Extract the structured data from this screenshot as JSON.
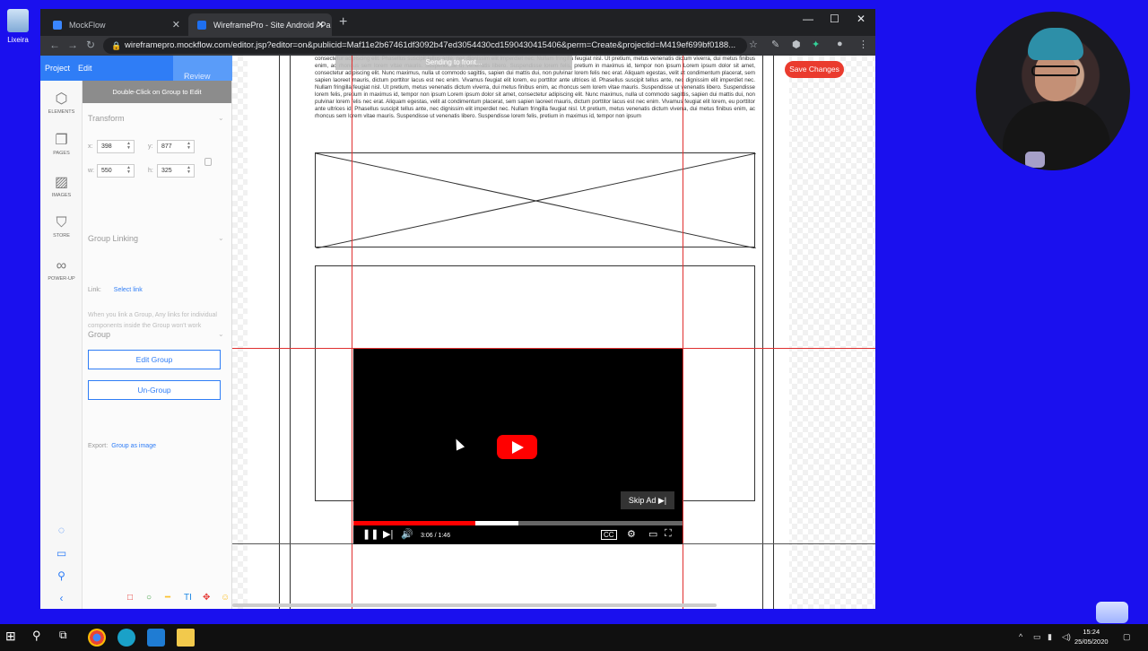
{
  "desktop": {
    "recycle_label": "Lixeira"
  },
  "browser": {
    "tabs": [
      {
        "label": "MockFlow",
        "active": false
      },
      {
        "label": "WireframePro - Site Android / Pa",
        "active": true
      }
    ],
    "url": "wireframepro.mockflow.com/editor.jsp?editor=on&publicid=Maf11e2b67461df3092b47ed3054430cd1590430415406&perm=Create&projectid=M419ef699bf0188..."
  },
  "app": {
    "menu": {
      "project": "Project",
      "edit": "Edit",
      "review": "Review"
    },
    "rail": [
      {
        "label": "ELEMENTS",
        "icon": "cube-icon"
      },
      {
        "label": "PAGES",
        "icon": "pages-icon"
      },
      {
        "label": "IMAGES",
        "icon": "image-icon"
      },
      {
        "label": "STORE",
        "icon": "store-icon"
      },
      {
        "label": "POWER-UP",
        "icon": "infinity-icon"
      }
    ],
    "panel": {
      "hint": "Double-Click on Group to Edit",
      "transform_title": "Transform",
      "x_label": "x:",
      "x_value": "398",
      "y_label": "y:",
      "y_value": "877",
      "w_label": "w:",
      "w_value": "550",
      "h_label": "h:",
      "h_value": "325",
      "group_linking_title": "Group Linking",
      "link_label": "Link:",
      "select_link": "Select link",
      "link_note": "When you link a Group, Any links for individual components inside the Group won't work",
      "group_title": "Group",
      "edit_group": "Edit Group",
      "ungroup": "Un-Group",
      "export_label": "Export:",
      "export_link": "Group as image"
    },
    "canvas": {
      "sending": "Sending to front...",
      "save_changes": "Save Changes",
      "lorem": "consectetur adipiscing elit. Phasellus suscipit tellus ante, nec dignissim elit imperdiet nec. Nullam fringilla feugiat nisl. Ut pretium, metus venenatis dictum viverra, dui metus finibus enim, ac rhoncus sem lorem vitae mauris. Suspendisse ut venenatis libero. Suspendisse lorem felis, pretium in maximus id, tempor non ipsum Lorem ipsum dolor sit amet, consectetur adipiscing elit. Nunc maximus, nulla ut commodo sagittis, sapien dui mattis dui, non pulvinar lorem felis nec erat. Aliquam egestas, velit at condimentum placerat, sem sapien laoreet mauris, dictum porttitor lacus est nec enim. Vivamus feugiat elit lorem, eu porttitor ante ultrices id. Phasellus suscipit tellus ante, nec dignissim elit imperdiet nec. Nullam fringilla feugiat nisl. Ut pretium, metus venenatis dictum viverra, dui metus finibus enim, ac rhoncus sem lorem vitae mauris. Suspendisse ut venenatis libero. Suspendisse lorem felis, pretium in maximus id, tempor non ipsum Lorem ipsum dolor sit amet, consectetur adipiscing elit. Nunc maximus, nulla ut commodo sagittis, sapien dui mattis dui, non pulvinar lorem felis nec erat. Aliquam egestas, velit at condimentum placerat, sem sapien laoreet mauris, dictum porttitor lacus est nec enim. Vivamus feugiat elit lorem, eu porttitor ante ultrices id. Phasellus suscipit tellus ante, nec dignissim elit imperdiet nec. Nullam fringilla feugiat nisl. Ut pretium, metus venenatis dictum viverra, dui metus finibus enim, ac rhoncus sem lorem vitae mauris. Suspendisse ut venenatis libero. Suspendisse lorem felis, pretium in maximus id, tempor non ipsum",
      "video": {
        "skip_ad": "Skip Ad ▶|",
        "time": "3:06 / 1:46",
        "played_fraction": 0.37,
        "buffered_fraction": 0.5
      }
    }
  },
  "taskbar": {
    "time": "15:24",
    "date": "25/05/2020"
  }
}
